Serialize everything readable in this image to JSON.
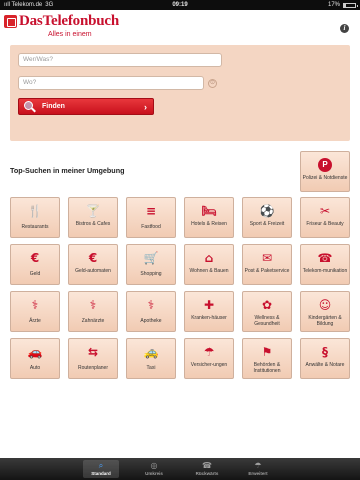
{
  "status_bar": {
    "carrier": "ııll Telekom.de",
    "network": "3G",
    "time": "09:19",
    "battery_percent": "17%",
    "battery_level": 0.17
  },
  "header": {
    "logo_text": "DasTelefonbuch",
    "tagline": "Alles in einem",
    "info_icon": "info-icon",
    "info_glyph": "i"
  },
  "search": {
    "what_placeholder": "Wer/Was?",
    "where_placeholder": "Wo?",
    "find_label": "Finden",
    "location_glyph": "⊙",
    "chevron_glyph": "›"
  },
  "section_title": "Top-Suchen in meiner Umgebung",
  "brand_color": "#c8102e",
  "tiles": {
    "polizei": {
      "label": "Polizei & Notdienste",
      "icon": "police-badge-icon",
      "glyph": "P"
    },
    "restaurants": {
      "label": "Restaurants",
      "icon": "fork-knife-icon",
      "glyph": "🍴"
    },
    "bistros": {
      "label": "Bistros & Cafes",
      "icon": "cocktail-glass-icon",
      "glyph": "🍸"
    },
    "fastfood": {
      "label": "Fastfood",
      "icon": "burger-icon",
      "glyph": "≡"
    },
    "hotels": {
      "label": "Hotels & Reisen",
      "icon": "bed-icon",
      "glyph": "🛏"
    },
    "sport": {
      "label": "Sport & Freizeit",
      "icon": "sport-icon",
      "glyph": "⚽"
    },
    "friseur": {
      "label": "Friseur & Beauty",
      "icon": "scissors-icon",
      "glyph": "✂"
    },
    "geld": {
      "label": "Geld",
      "icon": "credit-card-icon",
      "glyph": "€"
    },
    "geldautomaten": {
      "label": "Geld-automaten",
      "icon": "atm-icon",
      "glyph": "€"
    },
    "shopping": {
      "label": "Shopping",
      "icon": "shopping-cart-icon",
      "glyph": "🛒"
    },
    "wohnen": {
      "label": "Wohnen & Bauen",
      "icon": "house-icon",
      "glyph": "⌂"
    },
    "post": {
      "label": "Post & Paketservice",
      "icon": "envelope-icon",
      "glyph": "✉"
    },
    "telekom": {
      "label": "Telekom-munikation",
      "icon": "phone-icon",
      "glyph": "☎"
    },
    "aerzte": {
      "label": "Ärzte",
      "icon": "medical-staff-icon",
      "glyph": "⚕"
    },
    "zahnaerzte": {
      "label": "Zahnärzte",
      "icon": "tooth-staff-icon",
      "glyph": "⚕"
    },
    "apotheke": {
      "label": "Apotheke",
      "icon": "pharmacy-icon",
      "glyph": "⚕"
    },
    "krankenhaeuser": {
      "label": "Kranken-häuser",
      "icon": "hospital-icon",
      "glyph": "✚"
    },
    "wellness": {
      "label": "Wellness & Gesundheit",
      "icon": "wellness-icon",
      "glyph": "✿"
    },
    "kindergaerten": {
      "label": "Kindergärten & Bildung",
      "icon": "children-icon",
      "glyph": "☺"
    },
    "auto": {
      "label": "Auto",
      "icon": "car-icon",
      "glyph": "🚗"
    },
    "routenplaner": {
      "label": "Routenplaner",
      "icon": "signpost-icon",
      "glyph": "⇆"
    },
    "taxi": {
      "label": "Taxi",
      "icon": "taxi-icon",
      "glyph": "🚕"
    },
    "versicherungen": {
      "label": "Versicher-ungen",
      "icon": "umbrella-icon",
      "glyph": "☂"
    },
    "behoerden": {
      "label": "Behörden & Institutionen",
      "icon": "flag-icon",
      "glyph": "⚑"
    },
    "anwaelte": {
      "label": "Anwälte & Notare",
      "icon": "paragraph-icon",
      "glyph": "§"
    }
  },
  "tabbar": {
    "standard": {
      "label": "Standard",
      "icon": "search-icon",
      "glyph": "⌕"
    },
    "umkreis": {
      "label": "Umkreis",
      "icon": "radar-icon",
      "glyph": "◎"
    },
    "rueckwaerts": {
      "label": "Rückwärts",
      "icon": "reverse-phone-icon",
      "glyph": "☎"
    },
    "erweitert": {
      "label": "Erweitert",
      "icon": "umbrella-icon",
      "glyph": "☂"
    }
  }
}
